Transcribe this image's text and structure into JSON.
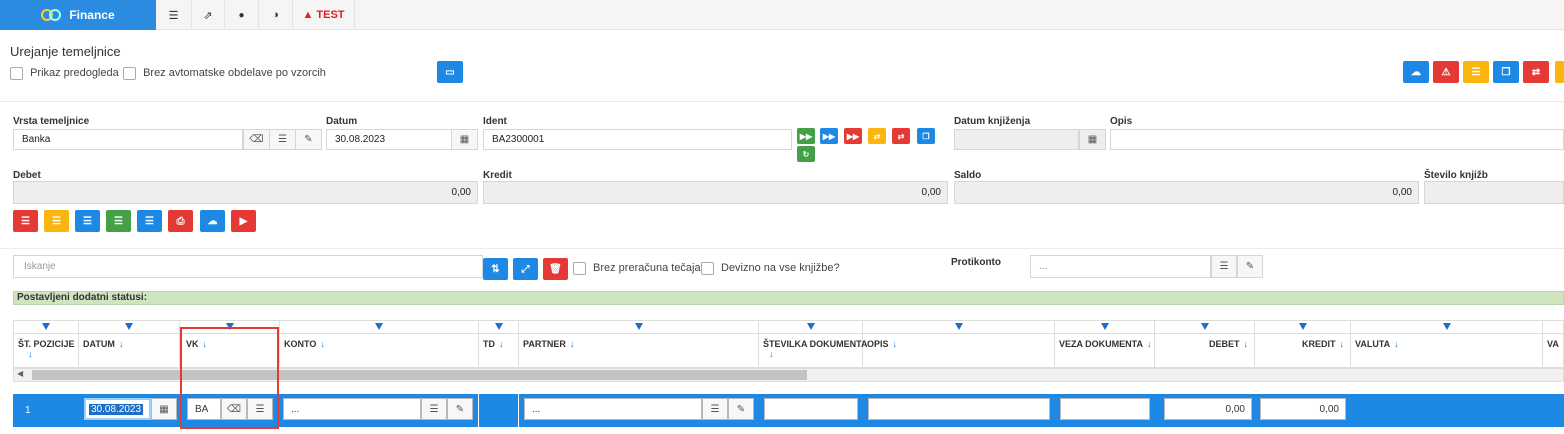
{
  "app": {
    "brand": "Finance",
    "test_label": "TEST",
    "colors": {
      "accent": "#1e88e5",
      "danger": "#e53935",
      "warning": "#fbb50f",
      "success": "#43a047"
    }
  },
  "topnav": [
    {
      "icon": "list-icon",
      "glyph": "☰"
    },
    {
      "icon": "external-link-icon",
      "glyph": "⇗"
    },
    {
      "icon": "lock-icon",
      "glyph": "🔒"
    },
    {
      "icon": "contrast-icon",
      "glyph": "◑"
    }
  ],
  "page": {
    "title": "Urejanje temeljnice",
    "chk_preview": "Prikaz predogleda",
    "chk_no_auto": "Brez avtomatske obdelave po vzorcih"
  },
  "form": {
    "vrsta_label": "Vrsta temeljnice",
    "vrsta_value": "Banka",
    "datum_label": "Datum",
    "datum_value": "30.08.2023",
    "ident_label": "Ident",
    "ident_value": "BA2300001",
    "datum_knj_label": "Datum knjiženja",
    "datum_knj_value": "",
    "opis_label": "Opis",
    "opis_value": "",
    "debet_label": "Debet",
    "debet_value": "0,00",
    "kredit_label": "Kredit",
    "kredit_value": "0,00",
    "saldo_label": "Saldo",
    "saldo_value": "0,00",
    "st_knjizb_label": "Število knjižb"
  },
  "search": {
    "placeholder": "Iskanje",
    "chk_tecaj": "Brez preračuna tečaja?",
    "chk_devizno": "Devizno na vse knjižbe?",
    "protikonto_label": "Protikonto",
    "protikonto_value": "..."
  },
  "status_bar": "Postavljeni dodatni statusi:",
  "columns": [
    "ŠT. POZICIJE",
    "DATUM",
    "VK",
    "KONTO",
    "TD",
    "PARTNER",
    "ŠTEVILKA DOKUMENTA",
    "OPIS",
    "VEZA DOKUMENTA",
    "DEBET",
    "KREDIT",
    "VALUTA",
    "VA"
  ],
  "row": {
    "pos": "1",
    "datum": "30.08.2023",
    "vk": "BA",
    "konto": "...",
    "partner": "...",
    "debet": "0,00",
    "kredit": "0,00"
  }
}
